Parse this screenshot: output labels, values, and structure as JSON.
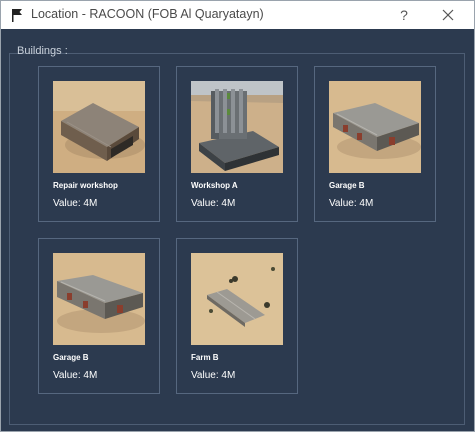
{
  "window": {
    "title": "Location - RACOON (FOB Al Quaryatayn)",
    "help_label": "?",
    "title_icon": "flag-icon",
    "close_icon": "close-icon"
  },
  "group": {
    "label": "Buildings :"
  },
  "value_label": "Value:",
  "buildings": [
    {
      "name": "Repair workshop",
      "value": "4M",
      "thumbnail": "repair-workshop-image"
    },
    {
      "name": "Workshop A",
      "value": "4M",
      "thumbnail": "workshop-a-image"
    },
    {
      "name": "Garage B",
      "value": "4M",
      "thumbnail": "garage-b-image"
    },
    {
      "name": "Garage B",
      "value": "4M",
      "thumbnail": "garage-b-image"
    },
    {
      "name": "Farm B",
      "value": "4M",
      "thumbnail": "farm-b-image"
    }
  ],
  "colors": {
    "panel_bg": "#2c3a4f",
    "card_border": "#56677f",
    "text": "#ffffff",
    "sand": "#d6b78a"
  }
}
